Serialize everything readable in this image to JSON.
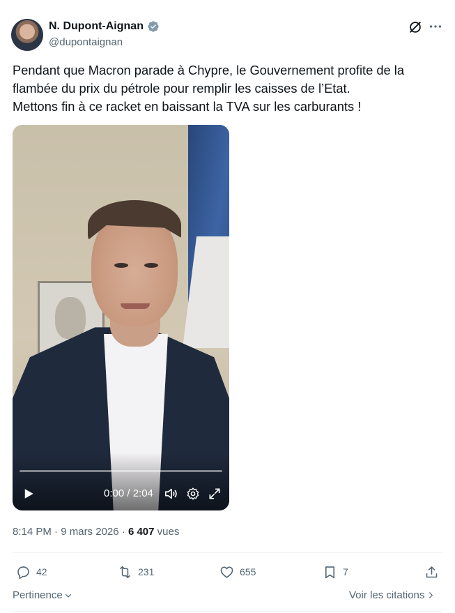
{
  "author": {
    "name": "N. Dupont-Aignan",
    "handle": "@dupontaignan",
    "verified_color": "#829aab"
  },
  "tweet": {
    "lines": [
      "Pendant que Macron parade à Chypre, le Gouvernement profite de la",
      "flambée du prix du pétrole pour remplir les caisses de l’Etat.",
      "Mettons fin à ce racket en baissant la TVA sur les carburants !"
    ]
  },
  "video": {
    "timecode": "0:00 / 2:04",
    "progress_fraction": 0.0,
    "icons": [
      "play-icon",
      "volume-icon",
      "settings-icon",
      "fullscreen-icon"
    ]
  },
  "meta": {
    "time": "8:14 PM",
    "separator": "·",
    "date": "9 mars 2026",
    "views_count": "6 407",
    "views_label": "vues"
  },
  "actions": {
    "replies": "42",
    "reposts": "231",
    "likes": "655",
    "bookmarks": "7"
  },
  "footer": {
    "sort_label": "Pertinence",
    "quotes_label": "Voir les citations"
  },
  "colors": {
    "text": "#0f1419",
    "muted": "#536471",
    "divider": "#eff3f4"
  }
}
